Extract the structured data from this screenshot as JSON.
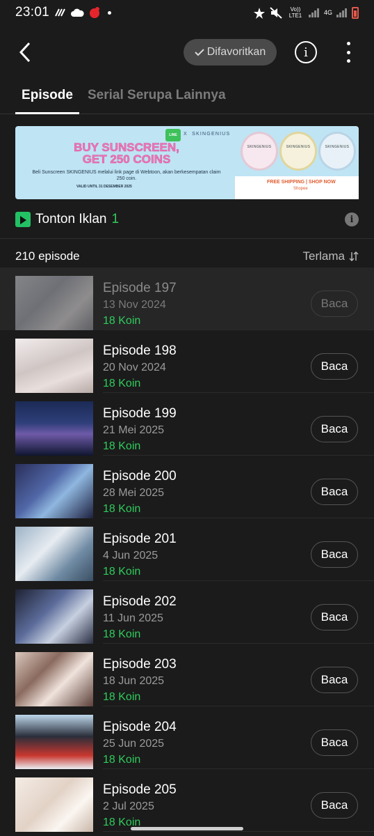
{
  "status_bar": {
    "time": "23:01",
    "network_label_1": "Vo)) LTE1",
    "network_label_2": "4G"
  },
  "header": {
    "favorite_label": "Difavoritkan"
  },
  "tabs": [
    {
      "label": "Episode",
      "active": true
    },
    {
      "label": "Serial Serupa Lainnya",
      "active": false
    }
  ],
  "banner": {
    "brand": "SKINGENIUS",
    "x_sign": "X",
    "headline_1": "BUY SUNSCREEN,",
    "headline_2": "GET 250 COINS",
    "description": "Beli Sunscreen SKINGENIUS melalui link page di Webtoon, akan berkesempatan claim 250 coin.",
    "valid": "VALID UNTIL 31 DESEMBER 2025",
    "shipping": "FREE SHIPPING | SHOP NOW",
    "shop": "Shopee",
    "product_labels": [
      "SKINGENIUS",
      "SKINGENIUS",
      "SKINGENIUS"
    ]
  },
  "ad": {
    "label": "Tonton Iklan",
    "count": "1"
  },
  "list": {
    "count_label": "210 episode",
    "sort_label": "Terlama"
  },
  "episodes": [
    {
      "title": "Episode 197",
      "date": "13 Nov 2024",
      "price": "18 Koin",
      "button": "Baca",
      "read": true
    },
    {
      "title": "Episode 198",
      "date": "20 Nov 2024",
      "price": "18 Koin",
      "button": "Baca",
      "read": false
    },
    {
      "title": "Episode 199",
      "date": "21 Mei 2025",
      "price": "18 Koin",
      "button": "Baca",
      "read": false
    },
    {
      "title": "Episode 200",
      "date": "28 Mei 2025",
      "price": "18 Koin",
      "button": "Baca",
      "read": false
    },
    {
      "title": "Episode 201",
      "date": "4 Jun 2025",
      "price": "18 Koin",
      "button": "Baca",
      "read": false
    },
    {
      "title": "Episode 202",
      "date": "11 Jun 2025",
      "price": "18 Koin",
      "button": "Baca",
      "read": false
    },
    {
      "title": "Episode 203",
      "date": "18 Jun 2025",
      "price": "18 Koin",
      "button": "Baca",
      "read": false
    },
    {
      "title": "Episode 204",
      "date": "25 Jun 2025",
      "price": "18 Koin",
      "button": "Baca",
      "read": false
    },
    {
      "title": "Episode 205",
      "date": "2 Jul 2025",
      "price": "18 Koin",
      "button": "Baca",
      "read": false
    }
  ],
  "colors": {
    "background": "#1b1b1b",
    "accent_green": "#2fcc5c",
    "read_row": "#262626"
  }
}
